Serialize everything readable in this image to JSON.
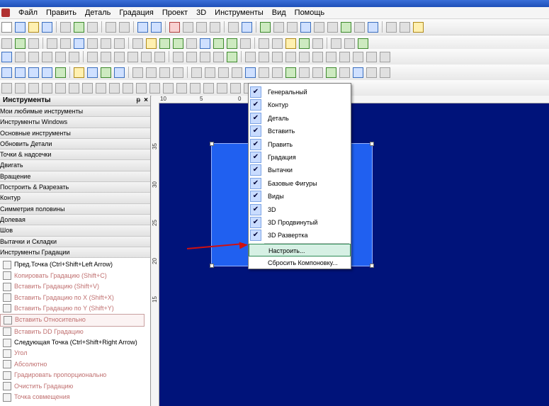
{
  "menu": [
    "Файл",
    "Править",
    "Деталь",
    "Градация",
    "Проект",
    "3D",
    "Инструменты",
    "Вид",
    "Помощь"
  ],
  "panel": {
    "title": "Инструменты",
    "pin": "ᵽ",
    "close": "×",
    "categories": [
      "Мои любимые инструменты",
      "Инструменты Windows",
      "Основные инструменты",
      "Обновить Детали",
      "Точки & надсечки",
      "Двигать",
      "Вращение",
      "Построить & Разрезать",
      "Контур",
      "Симметрия половины",
      "Долевая",
      "Шов",
      "Вытачки и Складки",
      "Инструменты Градации"
    ],
    "tools": [
      "Пред.Точка (Ctrl+Shift+Left Arrow)",
      "Копировать Градацию (Shift+C)",
      "Вставить Градацию (Shift+V)",
      "Вставить Градацию по X (Shift+X)",
      "Вставить Градацию по Y (Shift+Y)",
      "Вставить Относительно",
      "Вставить DD Градацию",
      "Следующая Точка (Ctrl+Shift+Right Arrow)",
      "Угол",
      "Абсолютно",
      "Градировать пропорционально",
      "Очистить Градацию",
      "Точка совмещения"
    ]
  },
  "ruler": {
    "top": [
      "10",
      "5",
      "0",
      "5"
    ],
    "left": [
      "35",
      "30",
      "25",
      "20",
      "15"
    ]
  },
  "context_menu": {
    "items": [
      {
        "label": "Генеральный",
        "checked": true
      },
      {
        "label": "Контур",
        "checked": true
      },
      {
        "label": "Деталь",
        "checked": true
      },
      {
        "label": "Вставить",
        "checked": true
      },
      {
        "label": "Править",
        "checked": true
      },
      {
        "label": "Градация",
        "checked": true
      },
      {
        "label": "Вытачки",
        "checked": true
      },
      {
        "label": "Базовые Фигуры",
        "checked": true
      },
      {
        "label": "Виды",
        "checked": true
      },
      {
        "label": "3D",
        "checked": true
      },
      {
        "label": "3D Продвинутый",
        "checked": true
      },
      {
        "label": "3D Развертка",
        "checked": true
      }
    ],
    "customize": "Настроить...",
    "reset": "Сбросить Компоновку...",
    "check_glyph": "✔"
  },
  "colors": {
    "canvas": "#00137a",
    "piece": "#2060f0",
    "arrow": "#d01010",
    "highlight": "#d6f0e4"
  }
}
